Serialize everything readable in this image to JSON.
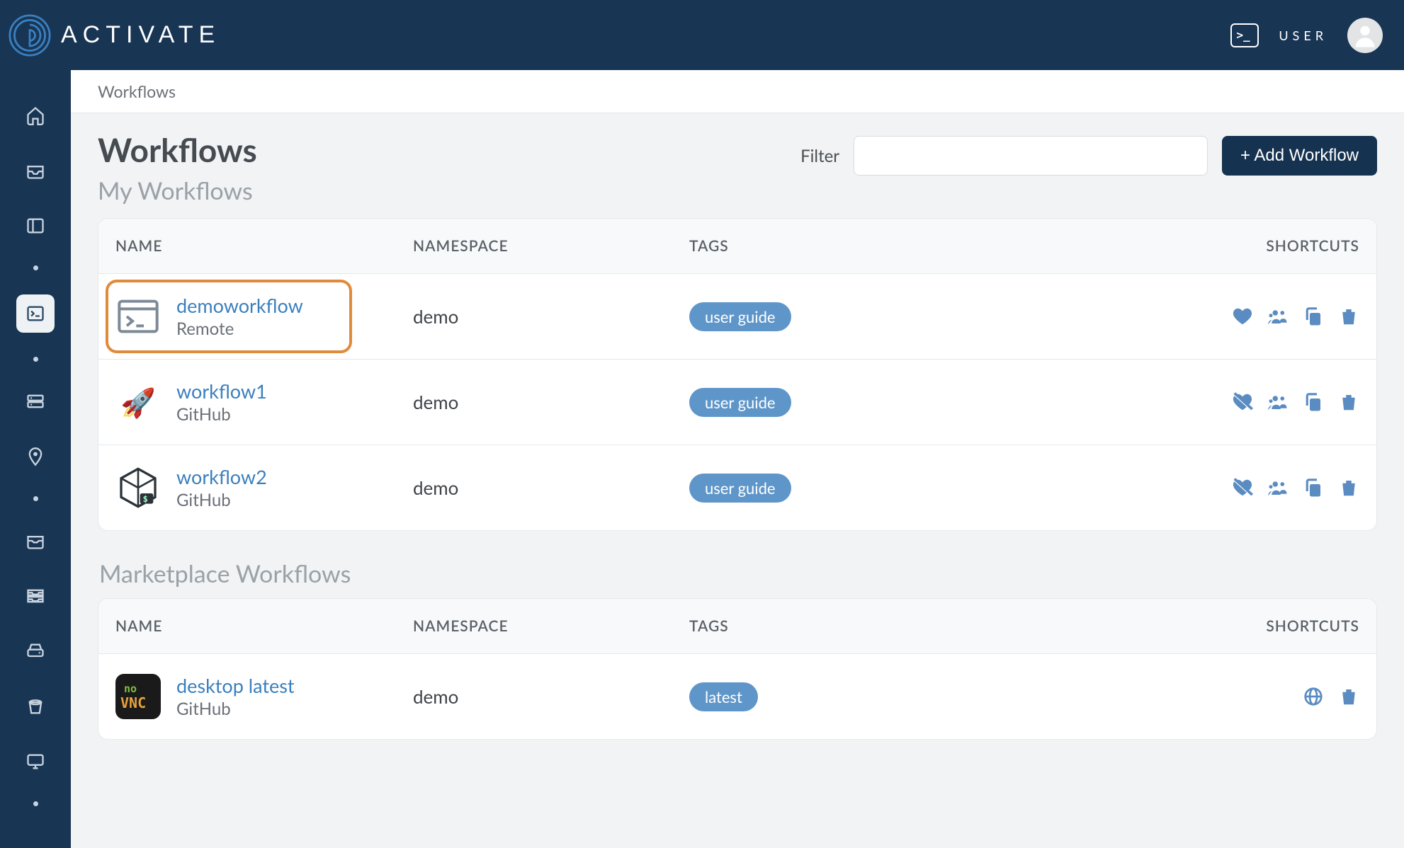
{
  "brand": {
    "name": "ACTIVATE"
  },
  "topnav": {
    "user_label": "USER"
  },
  "breadcrumb": "Workflows",
  "page": {
    "title": "Workflows",
    "subtitle": "My Workflows",
    "filter_label": "Filter",
    "filter_value": "",
    "add_button": "+ Add Workflow"
  },
  "columns": {
    "name": "NAME",
    "namespace": "NAMESPACE",
    "tags": "TAGS",
    "shortcuts": "SHORTCUTS"
  },
  "my_workflows": [
    {
      "name": "demoworkflow",
      "source": "Remote",
      "namespace": "demo",
      "tag": "user guide",
      "favorite": true,
      "icon": "terminal-window",
      "highlight": true
    },
    {
      "name": "workflow1",
      "source": "GitHub",
      "namespace": "demo",
      "tag": "user guide",
      "favorite": false,
      "icon": "rocket",
      "highlight": false
    },
    {
      "name": "workflow2",
      "source": "GitHub",
      "namespace": "demo",
      "tag": "user guide",
      "favorite": false,
      "icon": "cube-terminal",
      "highlight": false
    }
  ],
  "marketplace": {
    "section_title": "Marketplace Workflows",
    "items": [
      {
        "name": "desktop latest",
        "source": "GitHub",
        "namespace": "demo",
        "tag": "latest",
        "icon": "novnc"
      }
    ]
  }
}
